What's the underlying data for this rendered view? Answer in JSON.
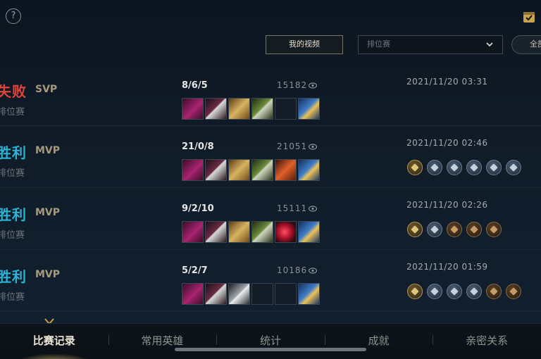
{
  "header": {
    "help_label": "?",
    "video_button": "我的视频",
    "mode_select": {
      "placeholder": "排位赛"
    },
    "all_button": "全部"
  },
  "matches": [
    {
      "result": "失败",
      "result_type": "lose",
      "badge": "SVP",
      "mode": "排位赛",
      "kda": "8/6/5",
      "score": "15182",
      "time": "2021/11/20 03:31",
      "items": [
        "magenta",
        "dark",
        "gold",
        "green",
        "empty",
        "blue"
      ],
      "medals": []
    },
    {
      "result": "胜利",
      "result_type": "win",
      "badge": "MVP",
      "mode": "排位赛",
      "kda": "21/0/8",
      "score": "21051",
      "time": "2021/11/20 02:46",
      "items": [
        "magenta",
        "dark",
        "gold",
        "green",
        "orange",
        "blue"
      ],
      "medals": [
        "gold",
        "silver",
        "silver",
        "silver",
        "silver",
        "silver"
      ]
    },
    {
      "result": "胜利",
      "result_type": "win",
      "badge": "MVP",
      "mode": "排位赛",
      "kda": "9/2/10",
      "score": "15111",
      "time": "2021/11/20 02:26",
      "items": [
        "magenta",
        "dark",
        "gold",
        "green",
        "red",
        "blue"
      ],
      "medals": [
        "gold",
        "silver",
        "bronze",
        "bronze",
        "bronze"
      ]
    },
    {
      "result": "胜利",
      "result_type": "win",
      "badge": "MVP",
      "mode": "排位赛",
      "kda": "5/2/7",
      "score": "10186",
      "time": "2021/11/20 01:59",
      "items": [
        "magenta",
        "dark",
        "silver",
        "empty",
        "empty",
        "blue"
      ],
      "medals": [
        "gold",
        "silver",
        "silver",
        "silver",
        "bronze",
        "bronze"
      ]
    }
  ],
  "nav": {
    "tabs": [
      "比赛记录",
      "常用英雄",
      "统计",
      "成就",
      "亲密关系"
    ],
    "active_index": 0
  },
  "colors": {
    "lose": "#e0453d",
    "win": "#2db3d6",
    "badge": "#a59a80",
    "accent_gold": "#e8c46e"
  }
}
